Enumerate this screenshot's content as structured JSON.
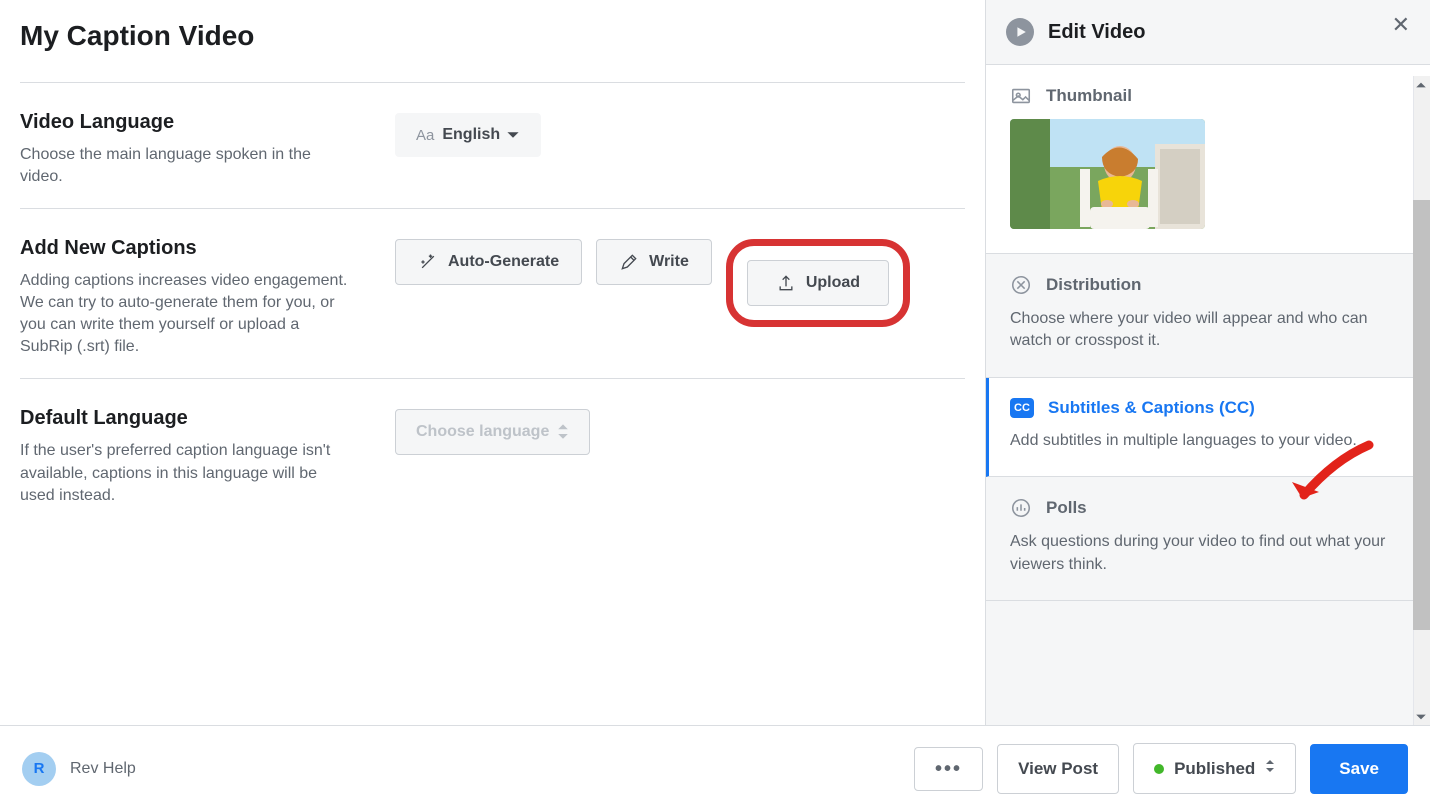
{
  "page_title": "My Caption Video",
  "video_lang": {
    "heading": "Video Language",
    "desc": "Choose the main language spoken in the video.",
    "prefix": "Aa",
    "value": "English"
  },
  "add_captions": {
    "heading": "Add New Captions",
    "desc": "Adding captions increases video engagement. We can try to auto-generate them for you, or you can write them yourself or upload a SubRip (.srt) file.",
    "auto_btn": "Auto-Generate",
    "write_btn": "Write",
    "upload_btn": "Upload"
  },
  "default_lang": {
    "heading": "Default Language",
    "desc": "If the user's preferred caption language isn't available, captions in this language will be used instead.",
    "placeholder": "Choose language"
  },
  "sidebar": {
    "title": "Edit Video",
    "thumbnail_label": "Thumbnail",
    "distribution": {
      "label": "Distribution",
      "desc": "Choose where your video will appear and who can watch or crosspost it."
    },
    "subtitles": {
      "label": "Subtitles & Captions (CC)",
      "desc": "Add subtitles in multiple languages to your video.",
      "badge": "CC"
    },
    "polls": {
      "label": "Polls",
      "desc": "Ask questions during your video to find out what your viewers think."
    }
  },
  "footer": {
    "avatar_initial": "R",
    "avatar_name": "Rev Help",
    "more": "•••",
    "view_post": "View Post",
    "published": "Published",
    "save": "Save"
  }
}
